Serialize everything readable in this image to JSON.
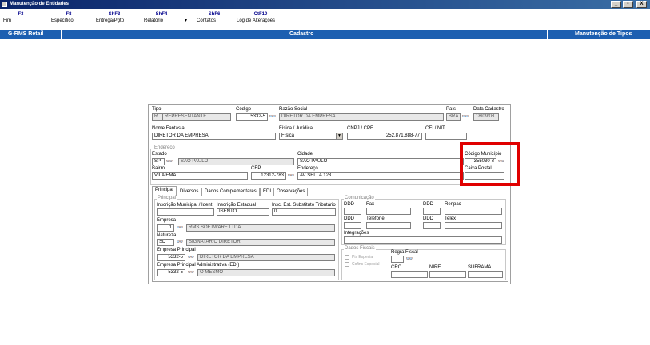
{
  "window": {
    "title": "Manutenção de Entidades",
    "min": "_",
    "max": "▫",
    "close": "X"
  },
  "toolbar": [
    {
      "key": "F3",
      "label": "Fim"
    },
    {
      "key": "F8",
      "label": "Específico"
    },
    {
      "key": "ShF3",
      "label": "Entrega/Pgto"
    },
    {
      "key": "ShF4",
      "label": "Relatório"
    },
    {
      "key": "ShF6",
      "label": "Contatos"
    },
    {
      "key": "CtF10",
      "label": "Log de Alterações"
    }
  ],
  "toolbar_arrow": "▾",
  "bluebar": {
    "left": "G-RMS Retail",
    "center": "Cadastro",
    "right": "Manutenção de Tipos"
  },
  "form": {
    "tipo": {
      "label": "Tipo",
      "code": "R",
      "value": "REPRESENTANTE"
    },
    "codigo": {
      "label": "Código",
      "value": "5332-5"
    },
    "razao": {
      "label": "Razão Social",
      "value": "DIRETOR DA EMPRESA"
    },
    "pais": {
      "label": "País",
      "value": "BRA"
    },
    "data_cadastro": {
      "label": "Data Cadastro",
      "value": "18/09/08"
    },
    "nome_fantasia": {
      "label": "Nome Fantasia",
      "value": "DIRETOR DA EMPRESA"
    },
    "fisica_juridica": {
      "label": "Física / Jurídica",
      "value": "Física"
    },
    "cnpj": {
      "label": "CNPJ / CPF",
      "value": "252.871.888-77"
    },
    "cei": {
      "label": "CEI / NIT",
      "value": ""
    },
    "endereco_group": "Endereco",
    "estado": {
      "label": "Estado",
      "code": "SP",
      "value": "SAO PAULO"
    },
    "cidade": {
      "label": "Cidade",
      "value": "SAO PAULO"
    },
    "codigo_municipio": {
      "label": "Código Município",
      "value": "355030-8"
    },
    "bairro": {
      "label": "Bairro",
      "value": "VILA EMA"
    },
    "cep": {
      "label": "CEP",
      "value": "12312-783"
    },
    "endereco": {
      "label": "Endereço",
      "value": "AV SEI LA 123"
    },
    "caixa_postal": {
      "label": "Caixa Postal",
      "value": ""
    },
    "tabs": [
      "Principal",
      "Diversos",
      "Dados Complementares",
      "EDI",
      "Observações"
    ],
    "principal": {
      "group": "Principal",
      "insc_municipal": {
        "label": "Inscrição Municipal / Ident",
        "value": ""
      },
      "insc_estadual": {
        "label": "Inscrição Estadual",
        "value": "ISENTO"
      },
      "insc_substituto": {
        "label": "Insc. Est. Substituto Tributário",
        "value": "0"
      },
      "empresa": {
        "label": "Empresa",
        "code": "1",
        "value": "RMS SOFTWARE LTDA."
      },
      "natureza": {
        "label": "Natureza",
        "code": "SD",
        "value": "SIGNATARIO DIRETOR"
      },
      "empresa_principal": {
        "label": "Empresa Principal",
        "code": "5332-5",
        "value": "DIRETOR DA EMPRESA"
      },
      "empresa_admin": {
        "label": "Empresa Principal Administrativa (EDI)",
        "code": "5332-5",
        "value": "O MESMO"
      }
    },
    "comunicacao": {
      "group": "Comunicação",
      "ddd1": "DDD",
      "fax": "Fax",
      "ddd2": "DDD",
      "renpac": "Renpac",
      "ddd3": "DDD",
      "telefone": "Telefone",
      "ddd4": "DDD",
      "telex": "Telex",
      "integracoes": "Integrações"
    },
    "dados_fiscais": {
      "group": "Dados Fiscais",
      "pis": "Pis Especial",
      "cofins": "Cofins Especial",
      "regra_fiscal": "Regra Fiscal",
      "crc": "CRC",
      "nire": "NIRE",
      "sufraba": "SUFRAMA"
    }
  },
  "bino_icon": "binoculars-icon",
  "bino_glyph": "👓",
  "accent": {
    "bluebar": "#1c5fb1",
    "highlight": "#e00000"
  }
}
